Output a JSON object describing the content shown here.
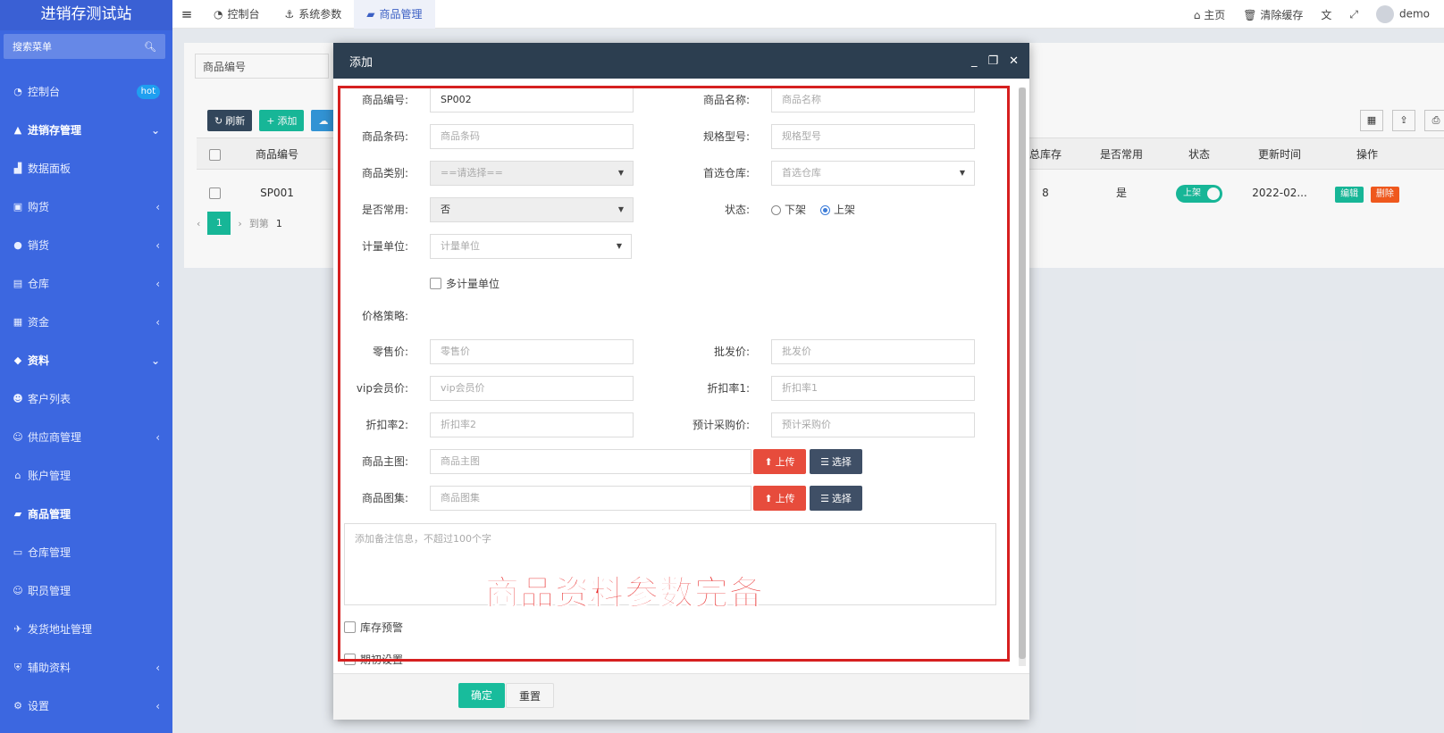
{
  "app": {
    "title": "进销存测试站",
    "search_placeholder": "搜索菜单",
    "user": "demo"
  },
  "sidebar": {
    "items": [
      {
        "label": "控制台",
        "badge": "hot"
      },
      {
        "label": "进销存管理"
      },
      {
        "label": "数据面板"
      },
      {
        "label": "购货"
      },
      {
        "label": "销货"
      },
      {
        "label": "仓库"
      },
      {
        "label": "资金"
      },
      {
        "label": "资料"
      },
      {
        "label": "客户列表"
      },
      {
        "label": "供应商管理"
      },
      {
        "label": "账户管理"
      },
      {
        "label": "商品管理"
      },
      {
        "label": "仓库管理"
      },
      {
        "label": "职员管理"
      },
      {
        "label": "发货地址管理"
      },
      {
        "label": "辅助资料"
      },
      {
        "label": "设置"
      }
    ]
  },
  "topbar": {
    "tabs": [
      {
        "label": "控制台"
      },
      {
        "label": "系统参数"
      },
      {
        "label": "商品管理"
      }
    ],
    "home": "主页",
    "clear_cache": "清除缓存"
  },
  "list": {
    "search_placeholder": "商品编号",
    "buttons": {
      "refresh": "刷新",
      "add": "添加"
    },
    "columns": {
      "code": "商品编号",
      "stock": "总库存",
      "common": "是否常用",
      "status": "状态",
      "updated": "更新时间",
      "action": "操作"
    },
    "row": {
      "code": "SP001",
      "stock": "8",
      "common": "是",
      "status": "上架",
      "updated": "2022-02...",
      "edit": "编辑",
      "delete": "删除"
    },
    "pager": {
      "page": "1",
      "goto": "到第",
      "goto_page": "1"
    }
  },
  "modal": {
    "title": "添加",
    "fields": {
      "code": {
        "label": "商品编号:",
        "value": "SP002"
      },
      "name": {
        "label": "商品名称:",
        "placeholder": "商品名称"
      },
      "barcode": {
        "label": "商品条码:",
        "placeholder": "商品条码"
      },
      "spec": {
        "label": "规格型号:",
        "placeholder": "规格型号"
      },
      "category": {
        "label": "商品类别:",
        "placeholder": "==请选择=="
      },
      "warehouse": {
        "label": "首选仓库:",
        "placeholder": "首选仓库"
      },
      "common": {
        "label": "是否常用:",
        "value": "否"
      },
      "status": {
        "label": "状态:",
        "off": "下架",
        "on": "上架"
      },
      "unit": {
        "label": "计量单位:",
        "placeholder": "计量单位"
      },
      "multi_unit": "多计量单位",
      "price_strategy": "价格策略:",
      "retail": {
        "label": "零售价:",
        "placeholder": "零售价"
      },
      "wholesale": {
        "label": "批发价:",
        "placeholder": "批发价"
      },
      "vip": {
        "label": "vip会员价:",
        "placeholder": "vip会员价"
      },
      "discount1": {
        "label": "折扣率1:",
        "placeholder": "折扣率1"
      },
      "discount2": {
        "label": "折扣率2:",
        "placeholder": "折扣率2"
      },
      "purchase": {
        "label": "预计采购价:",
        "placeholder": "预计采购价"
      },
      "main_image": {
        "label": "商品主图:",
        "placeholder": "商品主图"
      },
      "gallery": {
        "label": "商品图集:",
        "placeholder": "商品图集"
      },
      "remark_placeholder": "添加备注信息，不超过100个字",
      "stock_alert": "库存预警",
      "initial": "期初设置"
    },
    "upload": "上传",
    "select": "选择",
    "confirm": "确定",
    "reset": "重置"
  },
  "caption": "商品资料参数完备"
}
